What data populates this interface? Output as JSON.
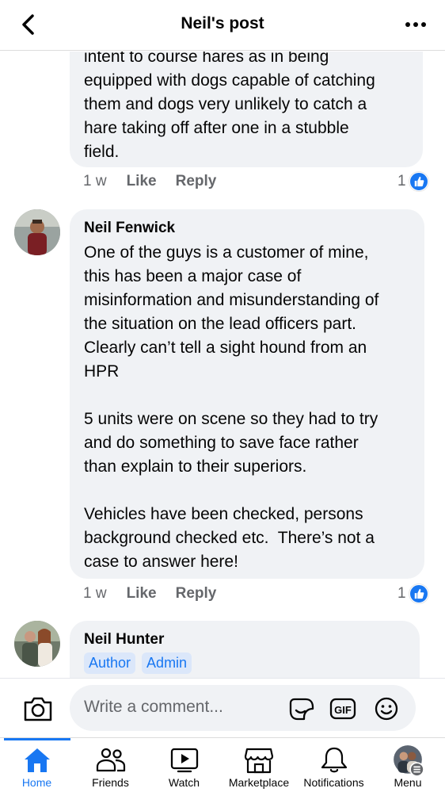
{
  "header": {
    "title": "Neil's post"
  },
  "comments": [
    {
      "text": "intent to course hares as in being\nequipped with dogs capable of catching\nthem and dogs very unlikely to catch a\nhare taking off after one in a stubble\nfield.",
      "time": "1 w",
      "like_label": "Like",
      "reply_label": "Reply",
      "reaction_count": "1"
    },
    {
      "author": "Neil Fenwick",
      "text": "One of the guys is a customer of mine,\nthis has been a major case of\nmisinformation and misunderstanding of\nthe situation on the lead officers part.\nClearly can’t tell a sight hound from an\nHPR\n\n5 units were on scene so they had to try\nand do something to save face rather\nthan explain to their superiors.\n\nVehicles have been checked, persons\nbackground checked etc.  There’s not a\ncase to answer here!",
      "time": "1 w",
      "like_label": "Like",
      "reply_label": "Reply",
      "reaction_count": "1"
    },
    {
      "author": "Neil Hunter",
      "badges": [
        "Author",
        "Admin"
      ]
    }
  ],
  "composer": {
    "placeholder": "Write a comment..."
  },
  "nav": {
    "tabs": [
      {
        "label": "Home",
        "icon": "home-icon"
      },
      {
        "label": "Friends",
        "icon": "friends-icon"
      },
      {
        "label": "Watch",
        "icon": "watch-icon"
      },
      {
        "label": "Marketplace",
        "icon": "marketplace-icon"
      },
      {
        "label": "Notifications",
        "icon": "bell-icon"
      },
      {
        "label": "Menu",
        "icon": "menu-icon"
      }
    ],
    "active": "Home"
  },
  "colors": {
    "accent": "#1877f2",
    "bubble": "#f0f2f5",
    "meta_text": "#65676b",
    "badge_bg": "#dbe7fa"
  }
}
